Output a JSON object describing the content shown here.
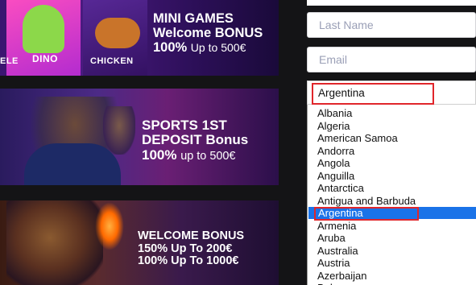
{
  "promos": [
    {
      "lines": [
        "MINI GAMES",
        "Welcome BONUS"
      ],
      "amount_line": {
        "pct": "100%",
        "rest": "Up to 500€"
      },
      "tiles": [
        "DINO",
        "CHICKEN"
      ],
      "tile_partial_label": "ELE"
    },
    {
      "lines": [
        "SPORTS 1ST",
        "DEPOSIT Bonus"
      ],
      "amount_line": {
        "pct": "100%",
        "rest": "up to 500€"
      }
    },
    {
      "lines": [
        "WELCOME BONUS",
        "150% Up To 200€",
        "100% Up To 1000€"
      ]
    }
  ],
  "form": {
    "last_name_placeholder": "Last Name",
    "email_placeholder": "Email",
    "country_value": "Argentina"
  },
  "country_options": [
    "Albania",
    "Algeria",
    "American Samoa",
    "Andorra",
    "Angola",
    "Anguilla",
    "Antarctica",
    "Antigua and Barbuda",
    "Argentina",
    "Armenia",
    "Aruba",
    "Australia",
    "Austria",
    "Azerbaijan",
    "Bahamas"
  ],
  "selected_option_index": 8,
  "colors": {
    "highlight_blue": "#1a73e8",
    "annotation_red": "#e0262b",
    "placeholder_gray": "#9a9fb6"
  }
}
